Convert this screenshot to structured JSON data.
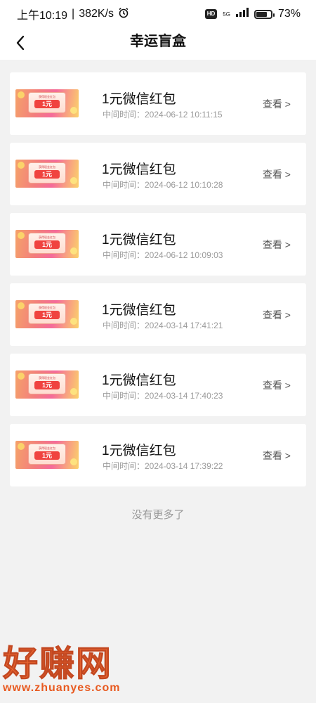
{
  "status_bar": {
    "time": "上午10:19",
    "speed": "382K/s",
    "hd": "HD",
    "network": "5G",
    "battery": "73%",
    "battery_level": 0.73
  },
  "nav": {
    "title": "幸运盲盒",
    "back_icon": "chevron-left-icon"
  },
  "items": [
    {
      "title": "1元微信红包",
      "time": "中间时间：2024-06-12 10:11:15",
      "action": "查看 >",
      "thumb_small": "获得现金红包",
      "thumb_amount": "1元"
    },
    {
      "title": "1元微信红包",
      "time": "中间时间：2024-06-12 10:10:28",
      "action": "查看 >",
      "thumb_small": "获得现金红包",
      "thumb_amount": "1元"
    },
    {
      "title": "1元微信红包",
      "time": "中间时间：2024-06-12 10:09:03",
      "action": "查看 >",
      "thumb_small": "获得现金红包",
      "thumb_amount": "1元"
    },
    {
      "title": "1元微信红包",
      "time": "中间时间：2024-03-14 17:41:21",
      "action": "查看 >",
      "thumb_small": "获得现金红包",
      "thumb_amount": "1元"
    },
    {
      "title": "1元微信红包",
      "time": "中间时间：2024-03-14 17:40:23",
      "action": "查看 >",
      "thumb_small": "获得现金红包",
      "thumb_amount": "1元"
    },
    {
      "title": "1元微信红包",
      "time": "中间时间：2024-03-14 17:39:22",
      "action": "查看 >",
      "thumb_small": "获得现金红包",
      "thumb_amount": "1元"
    }
  ],
  "footer": {
    "no_more": "没有更多了"
  },
  "watermark": {
    "text": "好赚网",
    "url": "www.zhuanyes.com"
  },
  "colors": {
    "background": "#f2f2f2",
    "card": "#ffffff",
    "watermark": "#e85a20"
  }
}
